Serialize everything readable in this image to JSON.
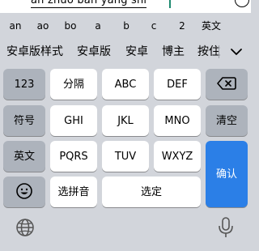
{
  "composition": {
    "text": "an zhuo ban yang shi",
    "status_icon": "circle-icon"
  },
  "pinyin_options": [
    "an",
    "ao",
    "bo",
    "a",
    "b",
    "c",
    "2",
    "英文"
  ],
  "candidates": [
    "安卓版样式",
    "安卓版",
    "安卓",
    "博主",
    "按住"
  ],
  "candidate_expand_icon": "chevron-down-icon",
  "keys": {
    "row1": [
      "123",
      "分隔",
      "ABC",
      "DEF"
    ],
    "backspace_icon": "backspace-icon",
    "row2": [
      "符号",
      "GHI",
      "JKL",
      "MNO",
      "清空"
    ],
    "row3": [
      "英文",
      "PQRS",
      "TUV",
      "WXYZ"
    ],
    "confirm": "确认",
    "emoji_icon": "emoji-icon",
    "row4": [
      "选拼音",
      "选定"
    ]
  },
  "bottom": {
    "globe_icon": "globe-icon",
    "mic_icon": "microphone-icon"
  },
  "colors": {
    "keyboard_bg": "#d2d5db",
    "light_key": "#ffffff",
    "dark_key": "#adb3bc",
    "accent": "#2b7fe7"
  }
}
